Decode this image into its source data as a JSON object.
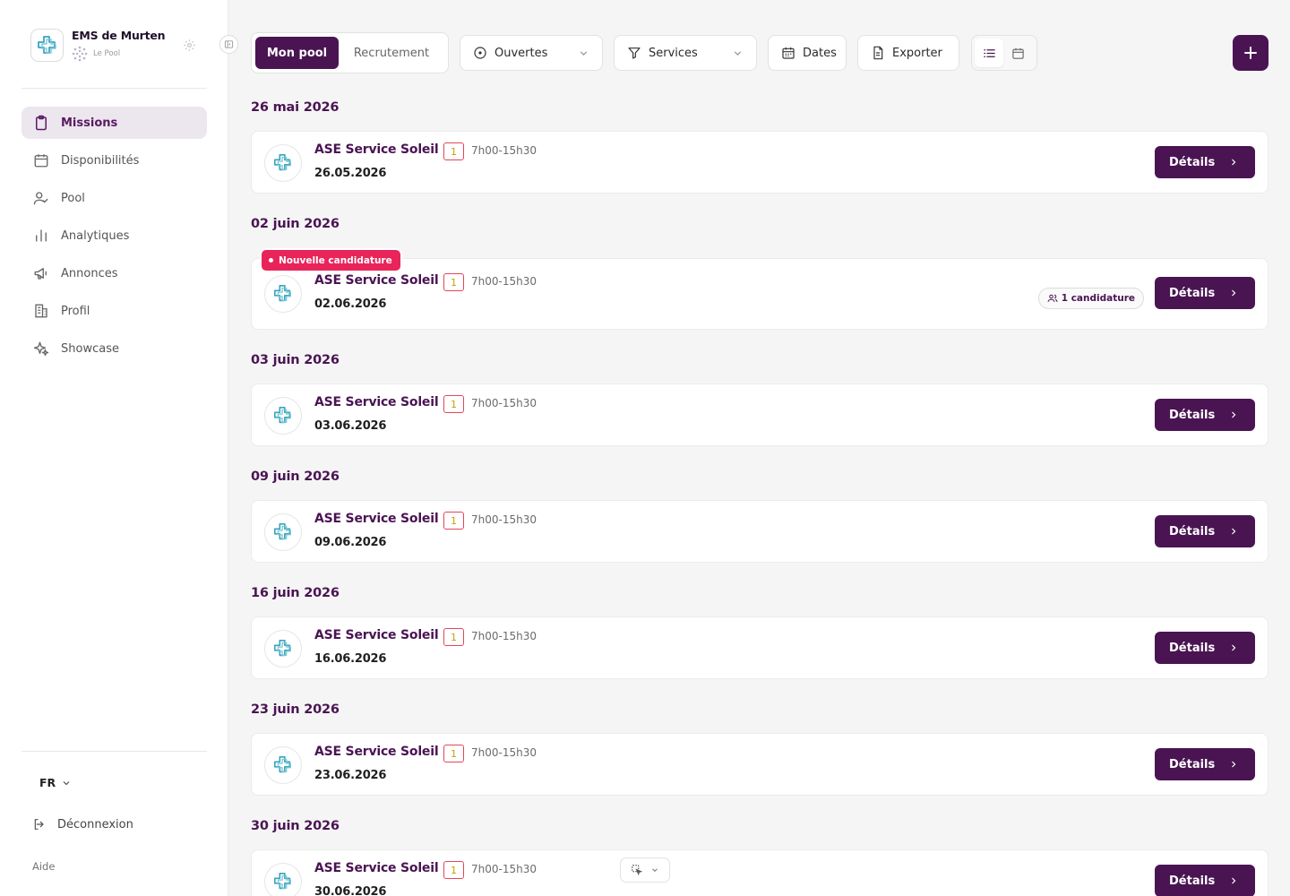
{
  "org": {
    "name": "EMS de Murten",
    "subtitle": "Le Pool"
  },
  "nav": [
    {
      "label": "Missions",
      "icon": "clipboard-icon",
      "active": true
    },
    {
      "label": "Disponibilités",
      "icon": "calendar-icon"
    },
    {
      "label": "Pool",
      "icon": "user-check-icon"
    },
    {
      "label": "Analytiques",
      "icon": "bar-chart-icon"
    },
    {
      "label": "Annonces",
      "icon": "megaphone-icon"
    },
    {
      "label": "Profil",
      "icon": "building-icon"
    },
    {
      "label": "Showcase",
      "icon": "sparkles-icon"
    }
  ],
  "footer": {
    "language": "FR",
    "logout": "Déconnexion",
    "help": "Aide"
  },
  "toolbar": {
    "tab_pool": "Mon pool",
    "tab_recruit": "Recrutement",
    "status_filter": "Ouvertes",
    "services_filter": "Services",
    "dates": "Dates",
    "export": "Exporter"
  },
  "missions": {
    "details_label": "Détails",
    "new_badge": "Nouvelle candidature",
    "groups": [
      {
        "date_heading": "26 mai 2026",
        "title": "ASE Service Soleil",
        "count": "1",
        "time": "7h00-15h30",
        "date": "26.05.2026"
      },
      {
        "date_heading": "02 juin 2026",
        "title": "ASE Service Soleil",
        "count": "1",
        "time": "7h00-15h30",
        "date": "02.06.2026",
        "candidatures": "1 candidature"
      },
      {
        "date_heading": "03 juin 2026",
        "title": "ASE Service Soleil",
        "count": "1",
        "time": "7h00-15h30",
        "date": "03.06.2026"
      },
      {
        "date_heading": "09 juin 2026",
        "title": "ASE Service Soleil",
        "count": "1",
        "time": "7h00-15h30",
        "date": "09.06.2026"
      },
      {
        "date_heading": "16 juin 2026",
        "title": "ASE Service Soleil",
        "count": "1",
        "time": "7h00-15h30",
        "date": "16.06.2026"
      },
      {
        "date_heading": "23 juin 2026",
        "title": "ASE Service Soleil",
        "count": "1",
        "time": "7h00-15h30",
        "date": "23.06.2026"
      },
      {
        "date_heading": "30 juin 2026",
        "title": "ASE Service Soleil",
        "count": "1",
        "time": "7h00-15h30",
        "date": "30.06.2026"
      }
    ]
  },
  "colors": {
    "brand": "#4a1453",
    "accent_new": "#e8245a",
    "count_border": "#e5455a",
    "count_text": "#c8a000",
    "logo_teal": "#3aa5bd"
  }
}
